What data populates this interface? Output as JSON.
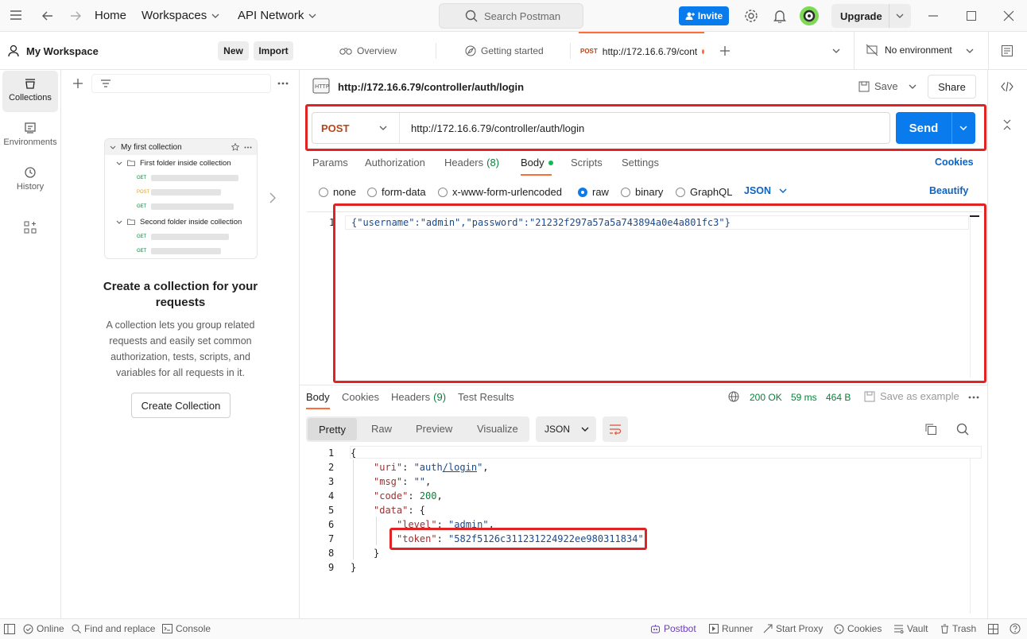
{
  "topbar": {
    "home": "Home",
    "workspaces": "Workspaces",
    "api_network": "API Network",
    "search_placeholder": "Search Postman",
    "invite": "Invite",
    "upgrade": "Upgrade"
  },
  "workspace": {
    "name": "My Workspace",
    "new_label": "New",
    "import_label": "Import"
  },
  "leftrail": {
    "items": [
      {
        "label": "Collections",
        "icon": "collections-icon"
      },
      {
        "label": "Environments",
        "icon": "environments-icon"
      },
      {
        "label": "History",
        "icon": "history-icon"
      },
      {
        "label": "",
        "icon": "apps-grid-icon"
      }
    ]
  },
  "collection_preview": {
    "title": "My first collection",
    "folder1": "First folder inside collection",
    "folder2": "Second folder inside collection",
    "methods": [
      "GET",
      "POST",
      "GET",
      "GET",
      "GET"
    ]
  },
  "empty_state": {
    "heading": "Create a collection for your requests",
    "body": "A collection lets you group related requests and easily set common authorization, tests, scripts, and variables for all requests in it.",
    "button": "Create Collection"
  },
  "tabs": {
    "overview": "Overview",
    "getting_started": "Getting started",
    "active_method": "POST",
    "active_url": "http://172.16.6.79/cont",
    "environment": "No environment"
  },
  "request": {
    "title": "http://172.16.6.79/controller/auth/login",
    "save": "Save",
    "share": "Share",
    "method": "POST",
    "url": "http://172.16.6.79/controller/auth/login",
    "send": "Send",
    "subtabs": [
      "Params",
      "Authorization",
      "Headers",
      "Body",
      "Scripts",
      "Settings"
    ],
    "headers_count": "(8)",
    "cookies": "Cookies",
    "body_types": [
      "none",
      "form-data",
      "x-www-form-urlencoded",
      "raw",
      "binary",
      "GraphQL"
    ],
    "body_format": "JSON",
    "beautify": "Beautify",
    "body_line_no": "1",
    "body_text": "{\"username\":\"admin\",\"password\":\"21232f297a57a5a743894a0e4a801fc3\"}"
  },
  "response": {
    "tabs": [
      "Body",
      "Cookies",
      "Headers",
      "Test Results"
    ],
    "headers_count": "(9)",
    "status": "200 OK",
    "time": "59 ms",
    "size": "464 B",
    "save_example": "Save as example",
    "view_modes": [
      "Pretty",
      "Raw",
      "Preview",
      "Visualize"
    ],
    "format": "JSON",
    "line_numbers": [
      "1",
      "2",
      "3",
      "4",
      "5",
      "6",
      "7",
      "8",
      "9"
    ],
    "json": {
      "uri_key": "\"uri\"",
      "uri_val_a": "\"auth",
      "uri_val_b": "/login",
      "uri_val_c": "\"",
      "msg_key": "\"msg\"",
      "msg_val": "\"\"",
      "code_key": "\"code\"",
      "code_val": "200",
      "data_key": "\"data\"",
      "level_key": "\"level\"",
      "level_val": "\"admin\"",
      "token_key": "\"token\"",
      "token_val": "\"582f5126c311231224922ee980311834\""
    }
  },
  "statusbar": {
    "online": "Online",
    "find_replace": "Find and replace",
    "console": "Console",
    "postbot": "Postbot",
    "runner": "Runner",
    "start_proxy": "Start Proxy",
    "cookies": "Cookies",
    "vault": "Vault",
    "trash": "Trash"
  },
  "colors": {
    "accent_orange": "#ff6c37",
    "send_blue": "#097bed",
    "status_green": "#0a7f3a",
    "highlight_red": "#e02424"
  }
}
